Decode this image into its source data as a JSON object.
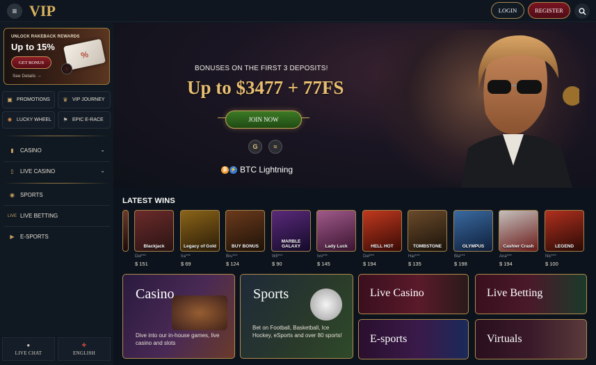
{
  "header": {
    "logo": "VIP",
    "login_label": "LOGIN",
    "register_label": "REGISTER",
    "menu_icon": "hamburger-icon",
    "search_icon": "search-icon"
  },
  "sidebar": {
    "promo": {
      "kicker": "UNLOCK RAKEBACK REWARDS",
      "headline": "Up to 15%",
      "button": "GET BONUS",
      "details": "See Details →",
      "ticket_symbol": "%"
    },
    "quick": [
      {
        "label": "PROMOTIONS",
        "icon": "gift-icon"
      },
      {
        "label": "VIP JOURNEY",
        "icon": "crown-icon"
      },
      {
        "label": "LUCKY WHEEL",
        "icon": "wheel-icon"
      },
      {
        "label": "EPIC E-RACE",
        "icon": "flag-icon"
      }
    ],
    "nav": [
      {
        "label": "CASINO",
        "icon": "slot-icon",
        "chevron": "⌄"
      },
      {
        "label": "LIVE CASINO",
        "icon": "cards-icon",
        "chevron": "⌄"
      },
      {
        "label": "SPORTS",
        "icon": "ball-icon"
      },
      {
        "label": "LIVE BETTING",
        "icon": "live-icon"
      },
      {
        "label": "E-SPORTS",
        "icon": "play-icon"
      }
    ],
    "live_chat": "LIVE CHAT",
    "language": "ENGLISH"
  },
  "hero": {
    "subtitle": "BONUSES ON THE FIRST 3 DEPOSITS!",
    "title": "Up to $3477 + 77FS",
    "cta": "JOIN NOW",
    "payment_icons": [
      "google-pay-icon",
      "wave-pay-icon"
    ],
    "btc_label": "BTC Lightning"
  },
  "latest_wins": {
    "title": "LATEST WINS",
    "items": [
      {
        "game": "Blackjack",
        "user": "Del***",
        "amount": "$ 151",
        "color_a": "#6b2a2a",
        "color_b": "#2a1414"
      },
      {
        "game": "Legacy of Gold",
        "user": "Ira***",
        "amount": "$ 69",
        "color_a": "#8a6418",
        "color_b": "#2b1c08"
      },
      {
        "game": "BUY BONUS",
        "user": "Bru***",
        "amount": "$ 124",
        "color_a": "#6b3a1c",
        "color_b": "#1e1208"
      },
      {
        "game": "MARBLE GALAXY",
        "user": "Wil***",
        "amount": "$ 90",
        "color_a": "#5a2a7a",
        "color_b": "#140a2a"
      },
      {
        "game": "Lady Luck",
        "user": "Ivo***",
        "amount": "$ 145",
        "color_a": "#a05a8a",
        "color_b": "#3a1430"
      },
      {
        "game": "HELL HOT",
        "user": "Del***",
        "amount": "$ 194",
        "color_a": "#c0391e",
        "color_b": "#3a0a06"
      },
      {
        "game": "TOMBSTONE",
        "user": "Har***",
        "amount": "$ 135",
        "color_a": "#6a4a2a",
        "color_b": "#1a120a"
      },
      {
        "game": "OLYMPUS",
        "user": "Bla***",
        "amount": "$ 198",
        "color_a": "#3a6aa0",
        "color_b": "#0e1e3a"
      },
      {
        "game": "Cashier Crash",
        "user": "Ana***",
        "amount": "$ 194",
        "color_a": "#c4c0bc",
        "color_b": "#6a1a1a"
      },
      {
        "game": "LEGEND",
        "user": "Nic***",
        "amount": "$ 100",
        "color_a": "#b0301e",
        "color_b": "#2a0a06"
      }
    ]
  },
  "categories": [
    {
      "name": "Casino",
      "desc": "Dive into our in-house games, live casino and slots"
    },
    {
      "name": "Sports",
      "desc": "Bet on Football, Basketball, Ice Hockey, eSports and over 80 sports!"
    },
    {
      "name": "Live Casino"
    },
    {
      "name": "Live Betting"
    },
    {
      "name": "E-sports"
    },
    {
      "name": "Virtuals"
    }
  ]
}
